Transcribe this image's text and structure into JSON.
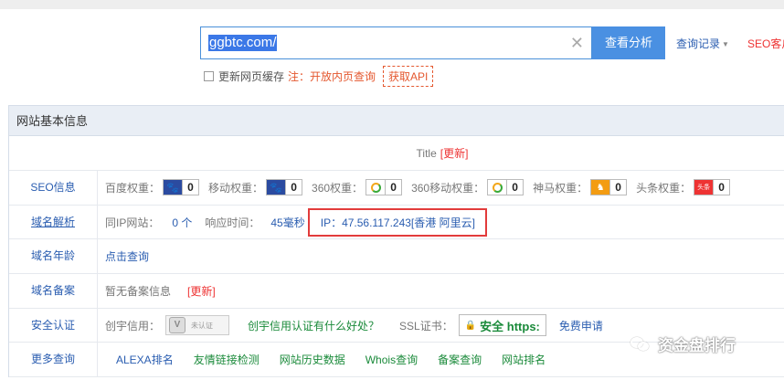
{
  "search": {
    "value": "ggbtc.com/",
    "clear_icon": "close-icon",
    "analyze_label": "查看分析",
    "history_label": "查询记录",
    "seo_label": "SEO客户"
  },
  "options": {
    "refresh_cache_label": "更新网页缓存",
    "note": "注：开放内页查询",
    "api_label": "获取API"
  },
  "panel": {
    "title": "网站基本信息",
    "title_row": {
      "label": "Title",
      "update": "[更新]"
    },
    "seo": {
      "label": "SEO信息",
      "items": [
        {
          "name": "百度权重：",
          "value": "0",
          "icon": "paw-icon"
        },
        {
          "name": "移动权重：",
          "value": "0",
          "icon": "paw-icon"
        },
        {
          "name": "360权重：",
          "value": "0",
          "icon": "ring-icon"
        },
        {
          "name": "360移动权重：",
          "value": "0",
          "icon": "ring-icon"
        },
        {
          "name": "神马权重：",
          "value": "0",
          "icon": "horse-icon"
        },
        {
          "name": "头条权重：",
          "value": "0",
          "icon": "toutiao-icon"
        }
      ]
    },
    "dns": {
      "label": "域名解析",
      "same_ip_label": "同IP网站：",
      "same_ip_value": "0 个",
      "response_label": "响应时间：",
      "response_value": "45毫秒",
      "ip_text": "IP：47.56.117.243[香港 阿里云]"
    },
    "age": {
      "label": "域名年龄",
      "link": "点击查询"
    },
    "icp": {
      "label": "域名备案",
      "text": "暂无备案信息",
      "update": "[更新]"
    },
    "security": {
      "label": "安全认证",
      "credit_label": "创宇信用：",
      "credit_badge": "未认证",
      "credit_question": "创宇信用认证有什么好处？",
      "ssl_label": "SSL证书：",
      "ssl_badge": "安全 https:",
      "ssl_apply": "免费申请"
    },
    "more": {
      "label": "更多查询",
      "links": [
        "ALEXA排名",
        "友情链接检测",
        "网站历史数据",
        "Whois查询",
        "备案查询",
        "网站排名"
      ]
    }
  },
  "watermark": {
    "text": "资金盘排行"
  },
  "colors": {
    "accent": "#4a90e2",
    "link": "#2a5db0",
    "alert": "#e23b3b",
    "green_link": "#1a8a3a"
  }
}
